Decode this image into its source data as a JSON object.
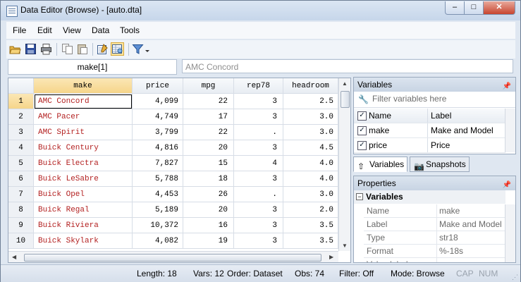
{
  "window": {
    "title": "Data Editor (Browse) - [auto.dta]",
    "controls": {
      "minimize": "–",
      "maximize": "□",
      "close": "✕"
    }
  },
  "menu": [
    "File",
    "Edit",
    "View",
    "Data",
    "Tools"
  ],
  "toolbar_icons": [
    "open-icon",
    "save-icon",
    "print-icon",
    "copy-icon",
    "paste-icon",
    "edit-mode-icon",
    "browse-mode-icon",
    "filter-icon",
    "dropdown-arrow-icon"
  ],
  "cell_name": "make[1]",
  "cell_value": "AMC Concord",
  "grid": {
    "columns": [
      "make",
      "price",
      "mpg",
      "rep78",
      "headroom"
    ],
    "rows": [
      {
        "n": "1",
        "make": "AMC Concord",
        "price": "4,099",
        "mpg": "22",
        "rep78": "3",
        "headroom": "2.5"
      },
      {
        "n": "2",
        "make": "AMC Pacer",
        "price": "4,749",
        "mpg": "17",
        "rep78": "3",
        "headroom": "3.0"
      },
      {
        "n": "3",
        "make": "AMC Spirit",
        "price": "3,799",
        "mpg": "22",
        "rep78": ".",
        "headroom": "3.0"
      },
      {
        "n": "4",
        "make": "Buick Century",
        "price": "4,816",
        "mpg": "20",
        "rep78": "3",
        "headroom": "4.5"
      },
      {
        "n": "5",
        "make": "Buick Electra",
        "price": "7,827",
        "mpg": "15",
        "rep78": "4",
        "headroom": "4.0"
      },
      {
        "n": "6",
        "make": "Buick LeSabre",
        "price": "5,788",
        "mpg": "18",
        "rep78": "3",
        "headroom": "4.0"
      },
      {
        "n": "7",
        "make": "Buick Opel",
        "price": "4,453",
        "mpg": "26",
        "rep78": ".",
        "headroom": "3.0"
      },
      {
        "n": "8",
        "make": "Buick Regal",
        "price": "5,189",
        "mpg": "20",
        "rep78": "3",
        "headroom": "2.0"
      },
      {
        "n": "9",
        "make": "Buick Riviera",
        "price": "10,372",
        "mpg": "16",
        "rep78": "3",
        "headroom": "3.5"
      },
      {
        "n": "10",
        "make": "Buick Skylark",
        "price": "4,082",
        "mpg": "19",
        "rep78": "3",
        "headroom": "3.5"
      }
    ]
  },
  "variables_panel": {
    "title": "Variables",
    "filter_placeholder": "Filter variables here",
    "col_name": "Name",
    "col_label": "Label",
    "items": [
      {
        "name": "make",
        "label": "Make and Model",
        "checked": true
      },
      {
        "name": "price",
        "label": "Price",
        "checked": true
      }
    ]
  },
  "tabs": {
    "variables": "Variables",
    "snapshots": "Snapshots"
  },
  "properties_panel": {
    "title": "Properties",
    "section": "Variables",
    "rows": [
      {
        "key": "Name",
        "value": "make"
      },
      {
        "key": "Label",
        "value": "Make and Model"
      },
      {
        "key": "Type",
        "value": "str18"
      },
      {
        "key": "Format",
        "value": "%-18s"
      },
      {
        "key": "Value label",
        "value": ""
      }
    ]
  },
  "status": {
    "length": "Length: 18",
    "vars": "Vars: 12",
    "order": "Order: Dataset",
    "obs": "Obs: 74",
    "filter": "Filter: Off",
    "mode": "Mode: Browse",
    "cap": "CAP",
    "num": "NUM"
  }
}
